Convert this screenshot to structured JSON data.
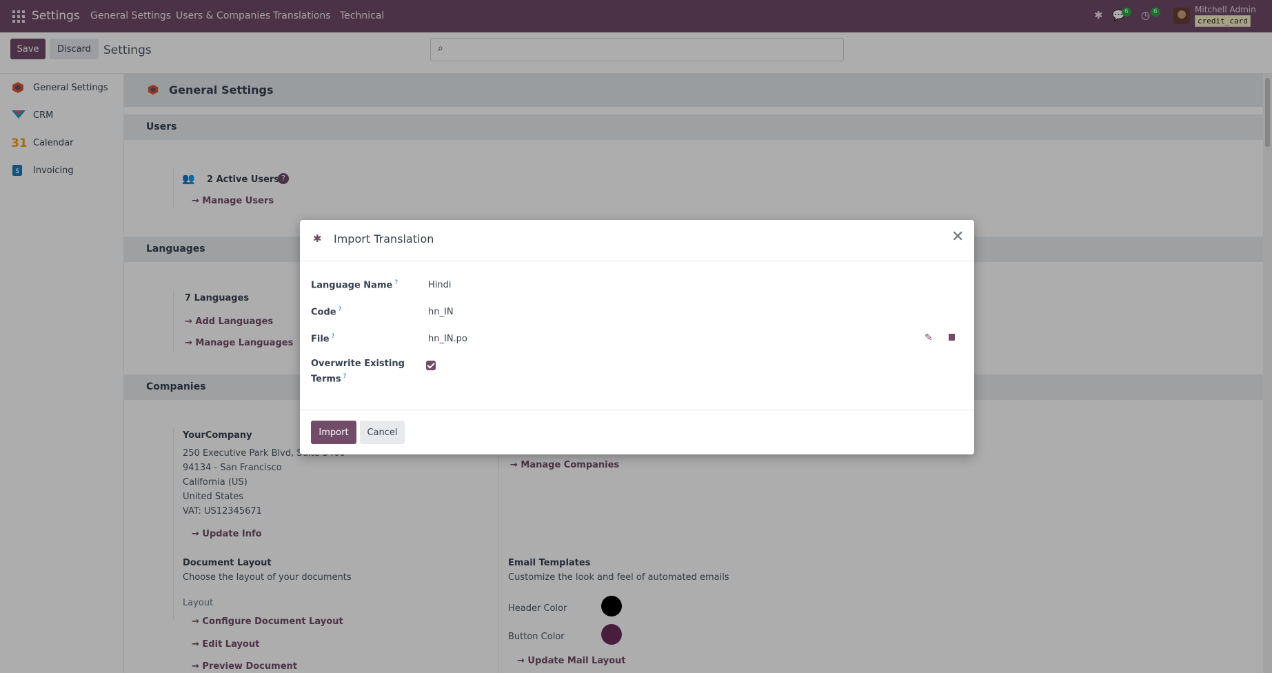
{
  "topbar": {
    "brand": "Settings",
    "menu": [
      "General Settings",
      "Users & Companies",
      "Translations",
      "Technical"
    ],
    "messages_count": "6",
    "activity_count": "6",
    "user_name": "Mitchell Admin",
    "user_chip": "credit_card"
  },
  "control": {
    "save": "Save",
    "discard": "Discard",
    "title": "Settings"
  },
  "sidebar": {
    "items": [
      "General Settings",
      "CRM",
      "Calendar",
      "Invoicing"
    ]
  },
  "main": {
    "header": "General Settings",
    "users": {
      "section": "Users",
      "active_users": "2 Active Users",
      "manage_users": "Manage Users"
    },
    "languages": {
      "section": "Languages",
      "count": "7 Languages",
      "add": "Add Languages",
      "manage": "Manage Languages"
    },
    "companies": {
      "section": "Companies",
      "company_name": "YourCompany",
      "address": [
        "250 Executive Park Blvd, Suite 3400",
        "94134 - San Francisco",
        "California (US)",
        "United States",
        "VAT:  US12345671"
      ],
      "update_info": "Update Info",
      "manage_companies": "Manage Companies"
    },
    "document_layout": {
      "title": "Document Layout",
      "desc": "Choose the layout of your documents",
      "layout_label": "Layout",
      "configure": "Configure Document Layout",
      "edit": "Edit Layout",
      "preview": "Preview Document"
    },
    "email_templates": {
      "title": "Email Templates",
      "desc": "Customize the look and feel of automated emails",
      "header_color_label": "Header Color",
      "button_color_label": "Button Color",
      "header_color": "#000000",
      "button_color": "#6b2d5c",
      "update_mail": "Update Mail Layout"
    }
  },
  "dialog": {
    "title": "Import Translation",
    "fields": {
      "language_name_label": "Language Name",
      "language_name": "Hindi",
      "code_label": "Code",
      "code": "hn_IN",
      "file_label": "File",
      "file": "hn_IN.po",
      "overwrite_label_1": "Overwrite Existing",
      "overwrite_label_2": "Terms",
      "overwrite": true
    },
    "help_marker": "?",
    "import": "Import",
    "cancel": "Cancel"
  },
  "colors": {
    "brand": "#714B67",
    "badge": "#28a745"
  }
}
